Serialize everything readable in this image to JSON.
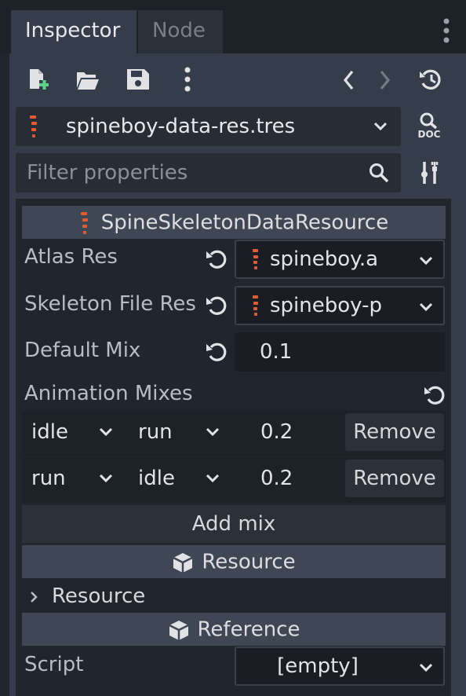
{
  "tabs": [
    {
      "label": "Inspector",
      "active": true
    },
    {
      "label": "Node",
      "active": false
    }
  ],
  "toolbar": {
    "icons": [
      "new-resource-icon",
      "open-folder-icon",
      "save-icon",
      "more-vertical-icon",
      "history-back-icon",
      "history-forward-icon",
      "history-icon"
    ]
  },
  "resource_selector": {
    "value": "spineboy-data-res.tres",
    "doc_label": "DOC"
  },
  "filter": {
    "placeholder": "Filter properties"
  },
  "section": {
    "title": "SpineSkeletonDataResource"
  },
  "properties": {
    "atlas_res": {
      "label": "Atlas Res",
      "value": "spineboy.a"
    },
    "skeleton_file_res": {
      "label": "Skeleton File Res",
      "value": "spineboy-p"
    },
    "default_mix": {
      "label": "Default Mix",
      "value": "0.1"
    }
  },
  "animation_mixes": {
    "label": "Animation Mixes",
    "rows": [
      {
        "from": "idle",
        "to": "run",
        "mix": "0.2",
        "remove_label": "Remove"
      },
      {
        "from": "run",
        "to": "idle",
        "mix": "0.2",
        "remove_label": "Remove"
      }
    ],
    "add_label": "Add mix"
  },
  "resource_section": {
    "title": "Resource",
    "subsection": "Resource"
  },
  "reference_section": {
    "title": "Reference",
    "script_label": "Script",
    "script_value": "[empty]"
  },
  "colors": {
    "background": "#21262e",
    "panel": "#363d4a",
    "accent_spine": "#e25b32"
  }
}
